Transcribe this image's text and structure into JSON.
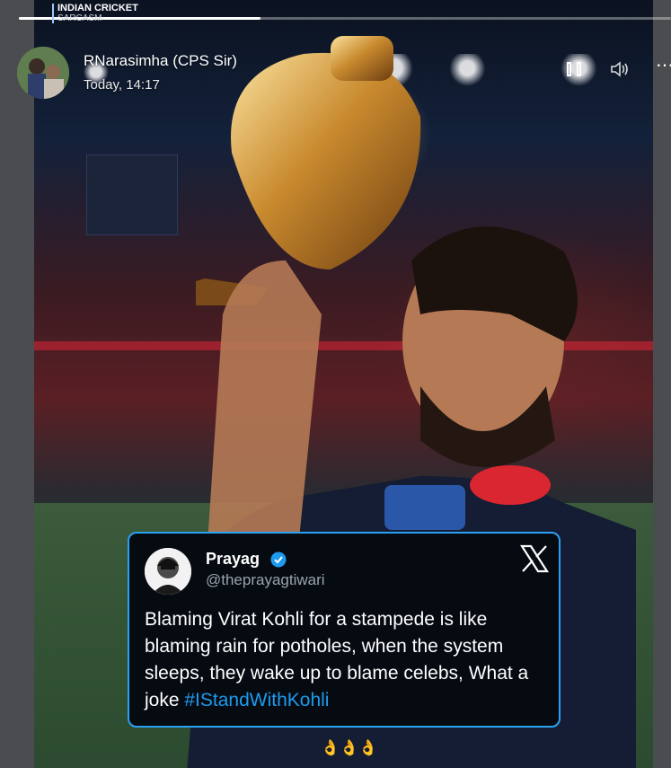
{
  "story": {
    "source_label_line1": "INDIAN CRICKET",
    "source_label_line2": "SARCASM",
    "progress": 0.37,
    "poster_name": "RNarasimha (CPS Sir)",
    "timestamp": "Today, 14:17",
    "controls": {
      "pause_icon": "pause-icon",
      "mute_icon": "volume-muted-icon",
      "more_icon": "more-horizontal-icon",
      "more_glyph": "⋯"
    },
    "reactions": "👌👌👌"
  },
  "tweet": {
    "author_name": "Prayag",
    "handle": "@theprayagtiwari",
    "verified": true,
    "body_text": "Blaming Virat Kohli for a stampede is like blaming rain for potholes, when the system sleeps, they wake up to blame celebs, What a joke ",
    "hashtag": "#IStandWithKohli",
    "platform_icon": "x-logo-icon"
  },
  "colors": {
    "tweet_border": "#2aa0f0",
    "hashtag": "#1d9bf0",
    "verified_badge": "#1d9bf0"
  }
}
